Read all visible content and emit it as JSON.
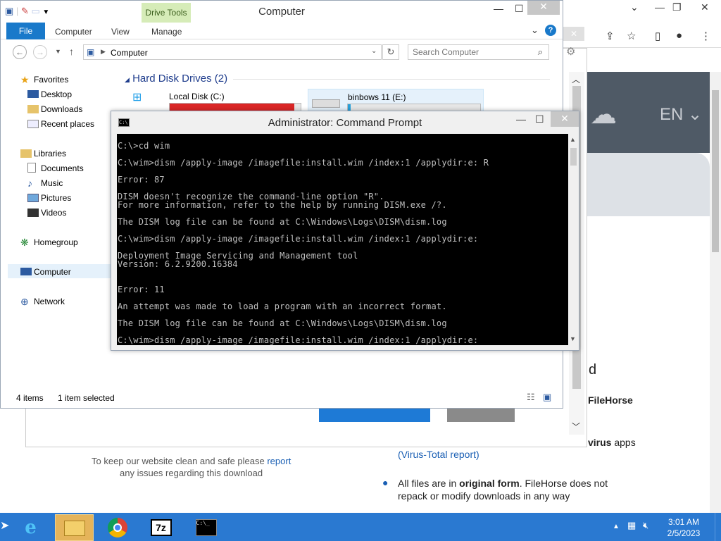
{
  "explorer": {
    "title": "Computer",
    "contextual_tab": "Drive Tools",
    "ribbon_tabs": [
      "File",
      "Computer",
      "View",
      "Manage"
    ],
    "address": "Computer",
    "search_placeholder": "Search Computer",
    "nav": {
      "favorites": "Favorites",
      "desktop": "Desktop",
      "downloads": "Downloads",
      "recent": "Recent places",
      "libraries": "Libraries",
      "documents": "Documents",
      "music": "Music",
      "pictures": "Pictures",
      "videos": "Videos",
      "homegroup": "Homegroup",
      "computer": "Computer",
      "network": "Network"
    },
    "group_header": "Hard Disk Drives (2)",
    "drives": [
      {
        "name": "Local Disk (C:)",
        "used_fraction": 0.95
      },
      {
        "name": "binbows 11 (E:)",
        "used_fraction": 0.02
      }
    ],
    "status_items": "4 items",
    "status_selected": "1 item selected"
  },
  "cmd": {
    "title": "Administrator: Command Prompt",
    "lines": [
      "C:\\>cd wim",
      "C:\\wim>dism /apply-image /imagefile:install.wim /index:1 /applydir:e: R",
      "Error: 87",
      "DISM doesn't recognize the command-line option \"R\".",
      "For more information, refer to the help by running DISM.exe /?.",
      "The DISM log file can be found at C:\\Windows\\Logs\\DISM\\dism.log",
      "C:\\wim>dism /apply-image /imagefile:install.wim /index:1 /applydir:e:",
      "Deployment Image Servicing and Management tool",
      "Version: 6.2.9200.16384",
      "Error: 11",
      "An attempt was made to load a program with an incorrect format.",
      "The DISM log file can be found at C:\\Windows\\Logs\\DISM\\dism.log",
      "C:\\wim>dism /apply-image /imagefile:install.wim /index:1 /applydir:e:"
    ]
  },
  "browser": {
    "lang": "EN",
    "heading_fragment": "d",
    "brand_fragment": "FileHorse",
    "virus_fragment_bold": "virus",
    "virus_fragment": " apps",
    "virus_total_link": "(Virus-Total report)",
    "original_form_pre": "All files are in ",
    "original_form_bold": "original form",
    "original_form_post": ". FileHorse does not",
    "original_form_line2": "repack or modify downloads in any way",
    "report_line1_pre": "To keep our website clean and safe please ",
    "report_link": "report",
    "report_line2": "any issues regarding this download"
  },
  "taskbar": {
    "time": "3:01 AM",
    "date": "2/5/2023",
    "apps": [
      "ie-icon",
      "file-explorer-icon",
      "chrome-icon",
      "7zip-icon",
      "cmd-icon"
    ],
    "sevenzip_label": "7z"
  },
  "colors": {
    "accent": "#1979ca",
    "taskbar": "#2a79d1",
    "drive_full": "#da2626",
    "drive_free": "#26a0da"
  }
}
